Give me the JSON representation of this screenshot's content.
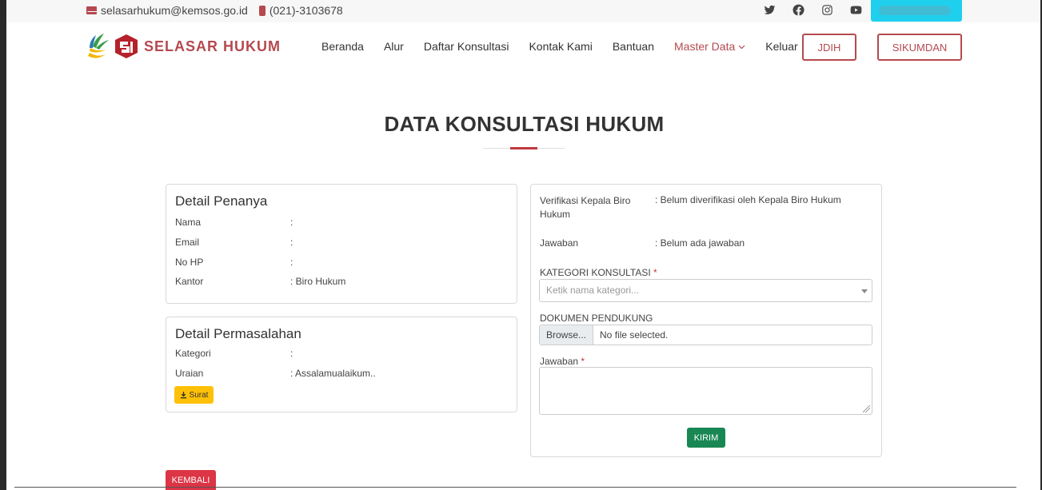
{
  "topbar": {
    "email": "selasarhukum@kemsos.go.id",
    "phone": "(021)-3103678",
    "socials": [
      "twitter-icon",
      "facebook-icon",
      "instagram-icon",
      "youtube-icon"
    ]
  },
  "brand": {
    "name": "SELASAR HUKUM",
    "color": "#b44a4f"
  },
  "nav": {
    "items": [
      "Beranda",
      "Alur",
      "Daftar Konsultasi",
      "Kontak Kami",
      "Bantuan",
      "Master Data",
      "Keluar"
    ],
    "active": "Master Data",
    "btn_jdih": "JDIH",
    "btn_sikumdan": "SIKUMDAN"
  },
  "page": {
    "title": "DATA KONSULTASI HUKUM"
  },
  "penanya": {
    "heading": "Detail Penanya",
    "rows": [
      {
        "label": "Nama",
        "value": ":"
      },
      {
        "label": "Email",
        "value": ":"
      },
      {
        "label": "No HP",
        "value": ":"
      },
      {
        "label": "Kantor",
        "value": ": Biro Hukum"
      }
    ]
  },
  "permasalahan": {
    "heading": "Detail Permasalahan",
    "rows": [
      {
        "label": "Kategori",
        "value": ":"
      },
      {
        "label": "Uraian",
        "value": ": Assalamualaikum.."
      }
    ],
    "surat_button": "Surat"
  },
  "verifikasi": {
    "label_line1": "Verifikasi Kepala Biro",
    "label_line2": "Hukum",
    "value": ": Belum diverifikasi oleh Kepala Biro Hukum",
    "jawaban_label": "Jawaban",
    "jawaban_value": ": Belum ada jawaban"
  },
  "form": {
    "kategori_label": "KATEGORI KONSULTASI",
    "kategori_placeholder": "Ketik nama kategori...",
    "dokumen_label": "DOKUMEN PENDUKUNG",
    "browse_label": "Browse...",
    "file_status": "No file selected.",
    "jawaban_label": "Jawaban",
    "required_mark": "*",
    "submit": "KIRIM"
  },
  "footer": {
    "back_button": "KEMBALI"
  }
}
